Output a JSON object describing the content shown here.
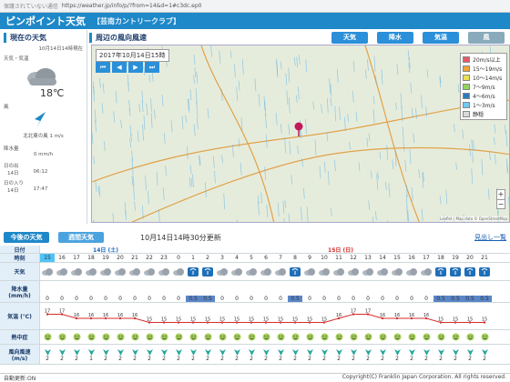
{
  "browser": {
    "warn": "保護されていない通信",
    "url": "https://weather.jp/info/p/?from=14&d=1#c3dc.ep0"
  },
  "app": {
    "title": "ピンポイント天気",
    "subtitle": "【芸南カントリークラブ】"
  },
  "now": {
    "heading": "現在の天気",
    "asof": "10月14日14時現在",
    "weather_label": "天気・気温",
    "temp": "18℃",
    "wind_label": "風",
    "wind": "北北東の風 1 m/s",
    "rain_label": "降水量",
    "rain": "0 mm/h",
    "sunrise_label": "日の出",
    "sunrise_day": "14日",
    "sunrise": "06:12",
    "sunset_label": "日の入り",
    "sunset_day": "14日",
    "sunset": "17:47"
  },
  "map": {
    "heading": "周辺の風向風速",
    "datetime": "2017年10月14日15時",
    "tabs": [
      "天気",
      "降水",
      "気温",
      "風"
    ],
    "legend": [
      "20m/s以上",
      "15～19m/s",
      "10～14m/s",
      "7～9m/s",
      "4～6m/s",
      "1～3m/s",
      "静穏"
    ],
    "legend_colors": [
      "#e35b6b",
      "#f0a23b",
      "#e8e05a",
      "#94d35b",
      "#2d7ab8",
      "#6fc9f1",
      "#d9d9d9"
    ],
    "attribution": "Leaflet | Map data © OpenStreetMap"
  },
  "forecast": {
    "tab_today": "今後の天気",
    "tab_week": "週間天気",
    "updated": "10月14日14時30分更新",
    "link": "見出し一覧",
    "date_label": "日付",
    "time_label": "時刻",
    "weather_label": "天気",
    "rain_label": "降水量\n(mm/h)",
    "temp_label": "気温\n(℃)",
    "heat_label": "熱中症",
    "wind_label": "風向風速\n(m/s)",
    "day1": "14日 (土)",
    "day2": "15日 (日)",
    "hours": [
      "15",
      "16",
      "17",
      "18",
      "19",
      "20",
      "21",
      "22",
      "23",
      "0",
      "1",
      "2",
      "3",
      "4",
      "5",
      "6",
      "7",
      "8",
      "9",
      "10",
      "11",
      "12",
      "13",
      "14",
      "15",
      "16",
      "17",
      "18",
      "19",
      "20",
      "21"
    ],
    "rain": [
      "0",
      "0",
      "0",
      "0",
      "0",
      "0",
      "0",
      "0",
      "0",
      "0",
      "0.5",
      "0.5",
      "0",
      "0",
      "0",
      "0",
      "0",
      "0.5",
      "0",
      "0",
      "0",
      "0",
      "0",
      "0",
      "0",
      "0",
      "0",
      "0.5",
      "0.5",
      "0.5",
      "0.5"
    ],
    "temp": [
      17,
      17,
      16,
      16,
      16,
      16,
      16,
      15,
      15,
      15,
      15,
      15,
      15,
      15,
      15,
      15,
      15,
      15,
      15,
      15,
      16,
      17,
      17,
      16,
      16,
      16,
      16,
      15,
      15,
      15,
      15
    ],
    "wind": [
      "2",
      "2",
      "2",
      "1",
      "2",
      "2",
      "2",
      "2",
      "2",
      "2",
      "2",
      "2",
      "2",
      "2",
      "2",
      "2",
      "2",
      "2",
      "2",
      "2",
      "2",
      "2",
      "2",
      "2",
      "2",
      "2",
      "2",
      "2",
      "2",
      "2",
      "2"
    ]
  },
  "status": {
    "left": "自動更新:ON",
    "right": "Copyright(C) Franklin Japan Corporation. All rights reserved."
  }
}
